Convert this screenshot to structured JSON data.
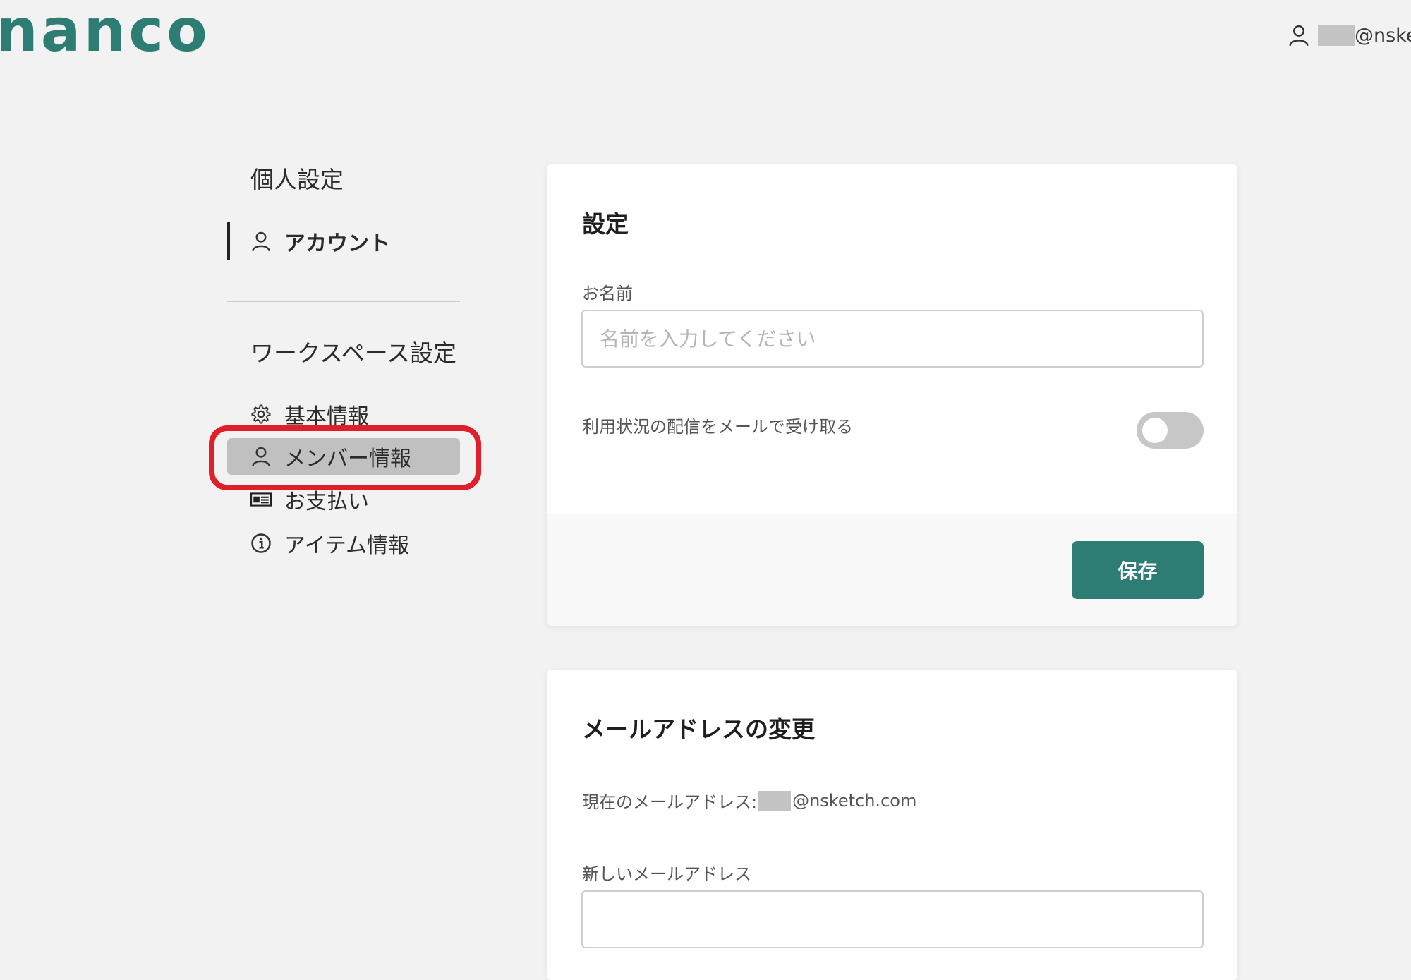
{
  "header": {
    "logo_text": "nanco",
    "user_email_suffix": "@nsket",
    "brand_color": "#2e7d74"
  },
  "sidebar": {
    "personal_heading": "個人設定",
    "account_label": "アカウント",
    "workspace_heading": "ワークスペース設定",
    "items": [
      {
        "label": "基本情報",
        "icon": "gear-icon"
      },
      {
        "label": "メンバー情報",
        "icon": "user-icon"
      },
      {
        "label": "お支払い",
        "icon": "id-card-icon"
      },
      {
        "label": "アイテム情報",
        "icon": "info-icon"
      }
    ]
  },
  "settings_card": {
    "title": "設定",
    "name_label": "お名前",
    "name_placeholder": "名前を入力してください",
    "name_value": "",
    "notify_label": "利用状況の配信をメールで受け取る",
    "notify_enabled": false,
    "save_label": "保存"
  },
  "email_card": {
    "title": "メールアドレスの変更",
    "current_label": "現在のメールアドレス:",
    "current_suffix": "@nsketch.com",
    "new_label": "新しいメールアドレス",
    "new_value": ""
  },
  "annotation": {
    "highlight_color": "#e01f2b"
  }
}
